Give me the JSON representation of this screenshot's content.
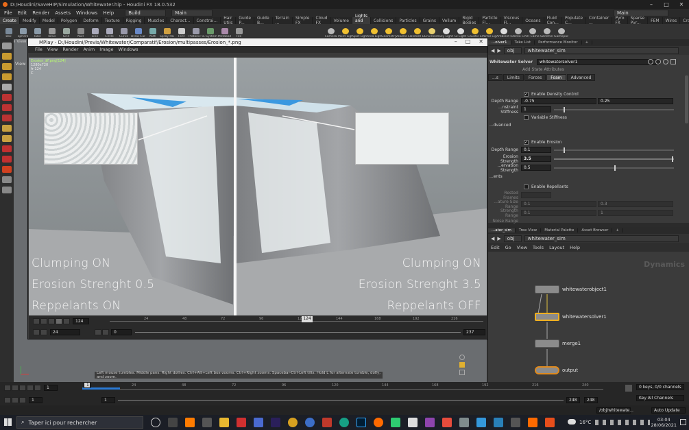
{
  "window": {
    "title": "D:/Houdini/SaveHIP/Simulation/Whitewater.hip - Houdini FX 18.0.532"
  },
  "menubar": {
    "items": [
      "File",
      "Edit",
      "Render",
      "Assets",
      "Windows",
      "Help"
    ],
    "build": "Build",
    "desktop": "Main"
  },
  "shelf_tabs_left": [
    "Create",
    "Modify",
    "Model",
    "Polygon",
    "Deform",
    "Texture",
    "Rigging",
    "Muscles",
    "Charact...",
    "Constrai...",
    "Hair Utils",
    "Guide P...",
    "Guide B...",
    "Terrain ...",
    "Simple FX",
    "Cloud FX",
    "Volume"
  ],
  "shelf_tabs_right": [
    "Lights and ...",
    "Collisions",
    "Particles",
    "Grains",
    "Vellum",
    "Rigid Bodies",
    "Particle Fl...",
    "Viscous Fl...",
    "Oceans",
    "Fluid Con...",
    "Populate C...",
    "Container ...",
    "Pyro FX",
    "Sparse Pyr...",
    "FEM",
    "Wires",
    "Crowds",
    "Drive Sim..."
  ],
  "shelf_tools_left": [
    "Box",
    "Sphere",
    "Tube",
    "Torus",
    "Grid",
    "Null",
    "Line",
    "Circle",
    "Curve",
    "Draw Curve",
    "Path",
    "Spray Paint",
    "Font",
    "Platonic Solids",
    "L-System",
    "Metaball",
    "File"
  ],
  "shelf_tools_right": [
    "Camera",
    "Point Light",
    "Spot Light",
    "Area Light",
    "Geometry Light",
    "Volume Light",
    "Distant Light",
    "Environment Light",
    "Sky Light",
    "GI Light",
    "Caustic Light",
    "Portal Light",
    "Ambient Light",
    "Stereo Camera",
    "VR Camera",
    "Switcher",
    "Gamepad Camera"
  ],
  "mplay": {
    "title": "MPlay - D:/Houdini/Previs/Whitewater/Comparatif/Erosion/multipasses/Erosion_*.png",
    "menu": [
      "File",
      "View",
      "Render",
      "Anim",
      "Image",
      "Windows"
    ],
    "info": [
      "Erosion_$F.png[124]",
      "1280x720",
      "fr 124",
      "C"
    ],
    "left_overlay": [
      "Clumping ON",
      "Erosion Strenght 0.5",
      "Reppelants ON"
    ],
    "right_overlay": [
      "Clumping ON",
      "Erosion Strenght 3.5",
      "Reppelants OFF"
    ],
    "frame": "124",
    "start": "24",
    "range_start": "0",
    "range_end": "237",
    "ticks": [
      "24",
      "48",
      "72",
      "96",
      "120",
      "144",
      "168",
      "192",
      "216"
    ],
    "current_frame_marker": "124"
  },
  "viewport": {
    "scene_view": "Scene View",
    "view_label": "View"
  },
  "right_pane_tabs": [
    "...olver1",
    "Take List",
    "Performance Monitor"
  ],
  "param_path": "whitewater_sim",
  "param_ctx": "obj",
  "node_header": {
    "type": "Whitewater Solver",
    "name": "whitewatersolver1",
    "add_state": "Add State Attributes"
  },
  "param_tabs": [
    "...s",
    "Limits",
    "Forces",
    "Foam",
    "Advanced"
  ],
  "params": {
    "enable_density": "Enable Density Control",
    "depth_range_label": "Depth Range",
    "depth_range_1": "-0.75",
    "depth_range_2": "0.25",
    "constraint_stiffness_label": "...nstraint Stiffness",
    "constraint_stiffness": "1",
    "variable_stiffness": "Variable Stiffness",
    "advanced_label": "...dvanced",
    "enable_erosion": "Enable Erosion",
    "erosion_depth_label": "Depth Range",
    "erosion_depth": "0.1",
    "erosion_strength_label": "Erosion Strength",
    "erosion_strength": "3.5",
    "preservation_label": "...ervation Strength",
    "preservation": "0.5",
    "ents_label": "...ents",
    "enable_repellants": "Enable Repellants",
    "rested_frames": "Rested Frames",
    "feature_size_range": "...ature Size Range",
    "feature_v1": "0.1",
    "feature_v2": "0.3",
    "strength_range": "Strength Range",
    "strength_v1": "0.1",
    "strength_v2": "1",
    "noise_range": "Noise Range"
  },
  "net_tabs": [
    "...ater_sim",
    "Tree View",
    "Material Palette",
    "Asset Browser"
  ],
  "net_ctx": "obj",
  "net_path": "whitewater_sim",
  "net_menu": [
    "Edit",
    "Go",
    "View",
    "Tools",
    "Layout",
    "Help"
  ],
  "net_watermark": "Dynamics",
  "nodes": [
    "whitewaterobject1",
    "whitewatersolver1",
    "merge1",
    "output"
  ],
  "status_message": "Left mouse tumbles. Middle pans. Right dollies. Ctrl+Alt+Left box-zooms. Ctrl+Right zooms. Spacebar-Ctrl-Left tilts. Hold L for alternate tumble, dolly, and zoom.",
  "main_timeline": {
    "frame": "1",
    "start": "1",
    "start2": "1",
    "end": "248",
    "end2": "248",
    "ticks": [
      "24",
      "48",
      "72",
      "96",
      "120",
      "144",
      "168",
      "192",
      "216",
      "240"
    ],
    "keys": "0 keys, 0/0 channels",
    "key_all": "Key All Channels",
    "auto_update": "Auto Update",
    "obj_path": "/obj/whitewate..."
  },
  "taskbar": {
    "search_placeholder": "Taper ici pour rechercher",
    "temp": "16°C",
    "time": "03:04",
    "date": "28/06/2021"
  },
  "colors": {
    "accent_yellow": "#f0b020",
    "node_output": "#e08a1c",
    "info_green": "#b8ff6a"
  }
}
